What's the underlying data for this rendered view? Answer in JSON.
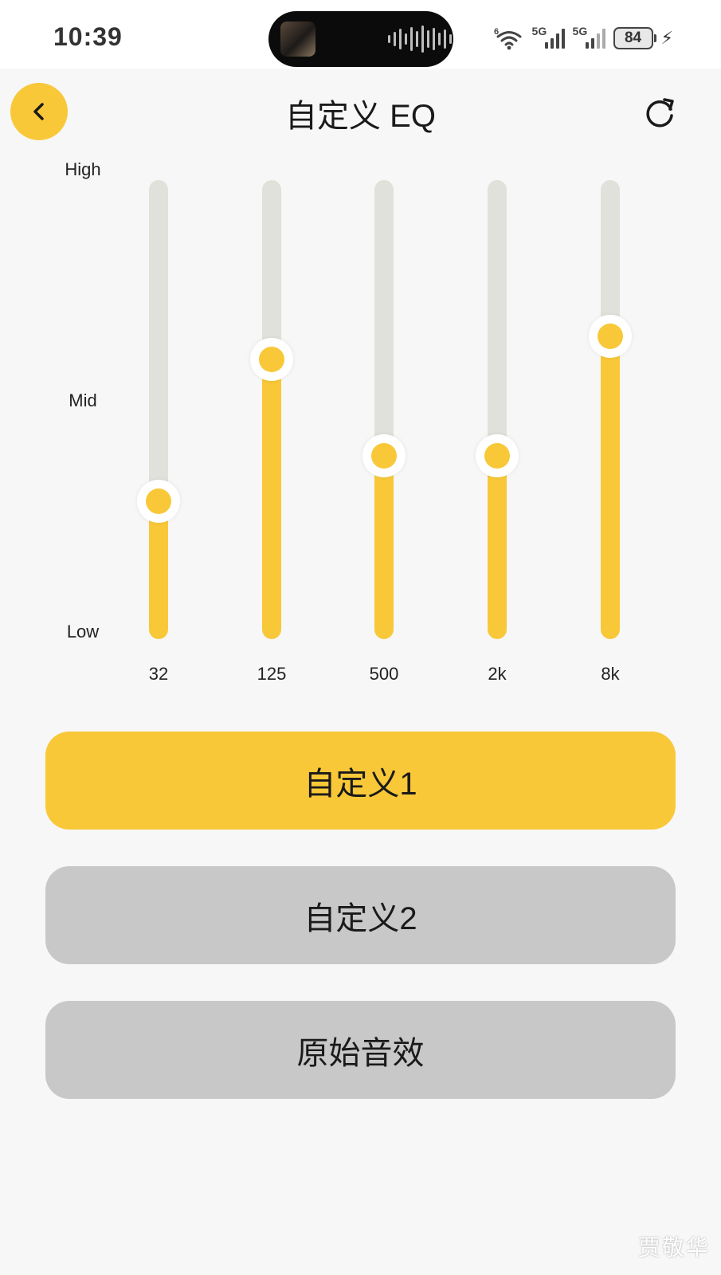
{
  "status_bar": {
    "time": "10:39",
    "signal1_tag": "5G",
    "signal2_tag": "5G",
    "battery": "84",
    "icons": [
      "wifi-icon",
      "cellular-signal-icon",
      "battery-icon",
      "charging-bolt-icon"
    ]
  },
  "header": {
    "title": "自定义 EQ",
    "back_icon": "chevron-left-icon",
    "reset_icon": "refresh-icon"
  },
  "levels": {
    "high": "High",
    "mid": "Mid",
    "low": "Low"
  },
  "eq": {
    "accent_color": "#f8c838",
    "track_color": "#e1e1dc",
    "bands": [
      {
        "label": "32",
        "level": 0.3
      },
      {
        "label": "125",
        "level": 0.61
      },
      {
        "label": "500",
        "level": 0.4
      },
      {
        "label": "2k",
        "level": 0.4
      },
      {
        "label": "8k",
        "level": 0.66
      }
    ]
  },
  "presets": [
    {
      "label": "自定义1",
      "active": true
    },
    {
      "label": "自定义2",
      "active": false
    },
    {
      "label": "原始音效",
      "active": false
    }
  ],
  "watermark": "贾敬华"
}
